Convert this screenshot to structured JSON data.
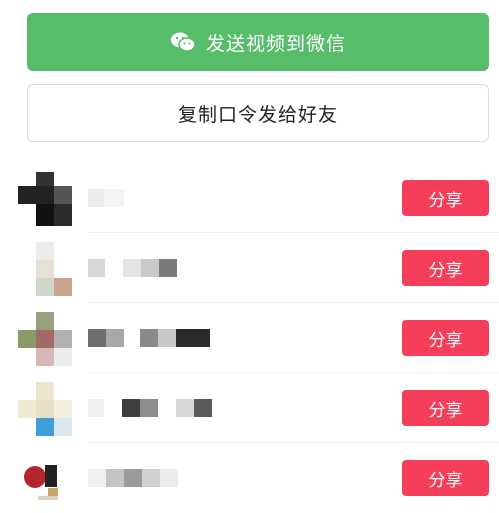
{
  "actions": {
    "wechat_label": "发送视频到微信",
    "copy_label": "复制口令发给好友"
  },
  "friends": [
    {
      "share_label": "分享"
    },
    {
      "share_label": "分享"
    },
    {
      "share_label": "分享"
    },
    {
      "share_label": "分享"
    },
    {
      "share_label": "分享"
    }
  ],
  "colors": {
    "wechat_green": "#57bd6a",
    "share_red": "#f53e5a"
  }
}
